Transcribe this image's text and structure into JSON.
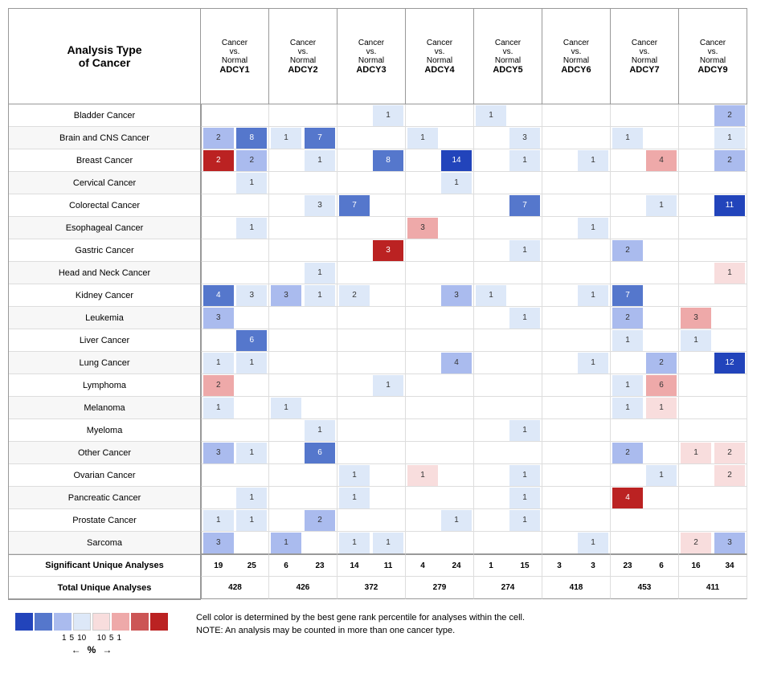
{
  "title": "Analysis Type\nof Cancer",
  "columns": [
    {
      "label": "Cancer\nvs.\nNormal",
      "gene": "ADCY1"
    },
    {
      "label": "Cancer\nvs.\nNormal",
      "gene": "ADCY2"
    },
    {
      "label": "Cancer\nvs.\nNormal",
      "gene": "ADCY3"
    },
    {
      "label": "Cancer\nvs.\nNormal",
      "gene": "ADCY4"
    },
    {
      "label": "Cancer\nvs.\nNormal",
      "gene": "ADCY5"
    },
    {
      "label": "Cancer\nvs.\nNormal",
      "gene": "ADCY6"
    },
    {
      "label": "Cancer\nvs.\nNormal",
      "gene": "ADCY7"
    },
    {
      "label": "Cancer\nvs.\nNormal",
      "gene": "ADCY9"
    }
  ],
  "rows": [
    {
      "label": "Bladder Cancer",
      "cells": [
        [
          "",
          ""
        ],
        [
          "",
          ""
        ],
        [
          "",
          ""
        ],
        [
          "1",
          "blue4"
        ],
        [
          "",
          ""
        ],
        [
          "1",
          "blue4"
        ],
        [
          "",
          ""
        ],
        [
          "",
          ""
        ],
        [
          "",
          ""
        ],
        [
          "2",
          "blue3"
        ]
      ]
    },
    {
      "label": "Brain and CNS Cancer",
      "cells": [
        [
          "2",
          "blue3"
        ],
        [
          "8",
          "blue2"
        ],
        [
          "1",
          "blue4"
        ],
        [
          "7",
          "blue2"
        ],
        [
          "",
          ""
        ],
        [
          "",
          ""
        ],
        [
          "1",
          "blue4"
        ],
        [
          "",
          ""
        ],
        [
          "3",
          "blue4"
        ],
        [
          "",
          ""
        ],
        [
          "",
          ""
        ],
        [
          "",
          ""
        ],
        [
          "1",
          "blue4"
        ],
        [
          "",
          ""
        ],
        [
          "",
          ""
        ],
        [
          "1",
          "blue4"
        ]
      ]
    },
    {
      "label": "Breast Cancer",
      "cells": [
        [
          "2",
          "red1"
        ],
        [
          "2",
          "blue3"
        ],
        [
          "",
          ""
        ],
        [
          "1",
          "blue4"
        ],
        [
          "",
          ""
        ],
        [
          "8",
          "blue2"
        ],
        [
          "",
          ""
        ],
        [
          "14",
          "blue1"
        ],
        [
          "",
          ""
        ],
        [
          "1",
          "blue4"
        ],
        [
          "",
          ""
        ],
        [
          "1",
          "blue4"
        ],
        [
          "",
          ""
        ],
        [
          "4",
          "pink2"
        ],
        [
          "",
          ""
        ],
        [
          "2",
          "blue3"
        ],
        [
          "",
          ""
        ]
      ]
    },
    {
      "label": "Cervical Cancer",
      "cells": [
        [
          "",
          ""
        ],
        [
          "1",
          "blue4"
        ],
        [
          "",
          ""
        ],
        [
          "",
          ""
        ],
        [
          "",
          ""
        ],
        [
          "",
          ""
        ],
        [
          "",
          ""
        ],
        [
          "1",
          "blue4"
        ],
        [
          "",
          ""
        ],
        [
          "",
          ""
        ],
        [
          "",
          ""
        ],
        [
          "",
          ""
        ],
        [
          "",
          ""
        ],
        [
          "",
          ""
        ],
        [
          "",
          ""
        ],
        [
          "",
          ""
        ]
      ]
    },
    {
      "label": "Colorectal Cancer",
      "cells": [
        [
          "",
          ""
        ],
        [
          "",
          ""
        ],
        [
          "",
          ""
        ],
        [
          "3",
          "blue4"
        ],
        [
          "7",
          "blue2"
        ],
        [
          "",
          ""
        ],
        [
          "",
          ""
        ],
        [
          "",
          ""
        ],
        [
          "",
          ""
        ],
        [
          "7",
          "blue2"
        ],
        [
          "",
          ""
        ],
        [
          "",
          ""
        ],
        [
          "",
          ""
        ],
        [
          "",
          ""
        ],
        [
          "1",
          "blue4"
        ],
        [
          "",
          ""
        ],
        [
          "11",
          "blue1"
        ]
      ]
    },
    {
      "label": "Esophageal Cancer",
      "cells": [
        [
          "",
          ""
        ],
        [
          "1",
          "blue4"
        ],
        [
          "",
          ""
        ],
        [
          "",
          ""
        ],
        [
          "",
          ""
        ],
        [
          "",
          ""
        ],
        [
          "3",
          "pink2"
        ],
        [
          "",
          ""
        ],
        [
          "",
          ""
        ],
        [
          "1",
          "blue4"
        ],
        [
          "",
          ""
        ],
        [
          "",
          ""
        ],
        [
          "",
          ""
        ],
        [
          "",
          ""
        ],
        [
          "",
          ""
        ]
      ]
    },
    {
      "label": "Gastric Cancer",
      "cells": [
        [
          "",
          ""
        ],
        [
          "",
          ""
        ],
        [
          "",
          ""
        ],
        [
          "",
          ""
        ],
        [
          "3",
          "red1"
        ],
        [
          "",
          ""
        ],
        [
          "",
          ""
        ],
        [
          "",
          ""
        ],
        [
          "",
          ""
        ],
        [
          "1",
          "blue4"
        ],
        [
          "",
          ""
        ],
        [
          "",
          ""
        ],
        [
          "2",
          "blue3"
        ],
        [
          "",
          ""
        ],
        [
          "",
          ""
        ]
      ]
    },
    {
      "label": "Head and Neck Cancer",
      "cells": [
        [
          "",
          ""
        ],
        [
          "",
          ""
        ],
        [
          "",
          ""
        ],
        [
          "1",
          "blue4"
        ],
        [
          "",
          ""
        ],
        [
          "",
          ""
        ],
        [
          "",
          ""
        ],
        [
          "",
          ""
        ],
        [
          "",
          ""
        ],
        [
          "",
          ""
        ],
        [
          "",
          ""
        ],
        [
          "",
          ""
        ],
        [
          "",
          ""
        ],
        [
          "",
          ""
        ],
        [
          "",
          ""
        ],
        [
          "1",
          "pink1"
        ]
      ]
    },
    {
      "label": "Kidney Cancer",
      "cells": [
        [
          "4",
          "blue2"
        ],
        [
          "3",
          "blue4"
        ],
        [
          "3",
          "blue3"
        ],
        [
          "1",
          "blue4"
        ],
        [
          "2",
          "blue4"
        ],
        [
          "",
          ""
        ],
        [
          "",
          ""
        ],
        [
          "3",
          "blue3"
        ],
        [
          "1",
          "blue4"
        ],
        [
          "",
          ""
        ],
        [
          "1",
          "blue4"
        ],
        [
          "",
          ""
        ],
        [
          "1",
          "blue4"
        ],
        [
          "7",
          "blue2"
        ],
        [
          "",
          ""
        ],
        [
          "",
          ""
        ]
      ]
    },
    {
      "label": "Leukemia",
      "cells": [
        [
          "3",
          "blue3"
        ],
        [
          "",
          ""
        ],
        [
          "",
          ""
        ],
        [
          "",
          ""
        ],
        [
          "",
          ""
        ],
        [
          "",
          ""
        ],
        [
          "",
          ""
        ],
        [
          "",
          ""
        ],
        [
          "",
          ""
        ],
        [
          "1",
          "blue4"
        ],
        [
          "",
          ""
        ],
        [
          "",
          ""
        ],
        [
          "2",
          "blue3"
        ],
        [
          "",
          ""
        ],
        [
          "3",
          "pink2"
        ],
        [
          "",
          ""
        ]
      ]
    },
    {
      "label": "Liver Cancer",
      "cells": [
        [
          "",
          ""
        ],
        [
          "6",
          "blue2"
        ],
        [
          "",
          ""
        ],
        [
          "",
          ""
        ],
        [
          "",
          ""
        ],
        [
          "",
          ""
        ],
        [
          "",
          ""
        ],
        [
          "",
          ""
        ],
        [
          "",
          ""
        ],
        [
          "",
          ""
        ],
        [
          "",
          ""
        ],
        [
          "",
          ""
        ],
        [
          "1",
          "blue4"
        ],
        [
          "",
          ""
        ],
        [
          "1",
          "blue4"
        ],
        [
          "",
          ""
        ]
      ]
    },
    {
      "label": "Lung Cancer",
      "cells": [
        [
          "1",
          "blue4"
        ],
        [
          "1",
          "blue4"
        ],
        [
          "",
          ""
        ],
        [
          "",
          ""
        ],
        [
          "",
          ""
        ],
        [
          "",
          ""
        ],
        [
          "",
          ""
        ],
        [
          "4",
          "blue3"
        ],
        [
          "",
          ""
        ],
        [
          "",
          ""
        ],
        [
          "",
          ""
        ],
        [
          "1",
          "blue4"
        ],
        [
          "",
          ""
        ],
        [
          "2",
          "blue3"
        ],
        [
          "",
          ""
        ],
        [
          "12",
          "blue1"
        ]
      ]
    },
    {
      "label": "Lymphoma",
      "cells": [
        [
          "2",
          "pink2"
        ],
        [
          "",
          ""
        ],
        [
          "",
          ""
        ],
        [
          "",
          ""
        ],
        [
          "1",
          "blue4"
        ],
        [
          "",
          ""
        ],
        [
          "",
          ""
        ],
        [
          "",
          ""
        ],
        [
          "",
          ""
        ],
        [
          "",
          ""
        ],
        [
          "",
          ""
        ],
        [
          "",
          ""
        ],
        [
          "1",
          "blue4"
        ],
        [
          "6",
          "pink2"
        ],
        [
          "",
          ""
        ]
      ]
    },
    {
      "label": "Melanoma",
      "cells": [
        [
          "1",
          "blue4"
        ],
        [
          "",
          ""
        ],
        [
          "1",
          "blue4"
        ],
        [
          "",
          ""
        ],
        [
          "",
          ""
        ],
        [
          "",
          ""
        ],
        [
          "",
          ""
        ],
        [
          "",
          ""
        ],
        [
          "",
          ""
        ],
        [
          "",
          ""
        ],
        [
          "",
          ""
        ],
        [
          "",
          ""
        ],
        [
          "1",
          "blue4"
        ],
        [
          "1",
          "pink1"
        ],
        [
          "",
          ""
        ]
      ]
    },
    {
      "label": "Myeloma",
      "cells": [
        [
          "",
          ""
        ],
        [
          "",
          ""
        ],
        [
          "",
          ""
        ],
        [
          "1",
          "blue4"
        ],
        [
          "",
          ""
        ],
        [
          "",
          ""
        ],
        [
          "",
          ""
        ],
        [
          "",
          ""
        ],
        [
          "",
          ""
        ],
        [
          "1",
          "blue4"
        ],
        [
          "",
          ""
        ],
        [
          "",
          ""
        ],
        [
          "",
          ""
        ],
        [
          "",
          ""
        ],
        [
          "",
          ""
        ]
      ]
    },
    {
      "label": "Other Cancer",
      "cells": [
        [
          "3",
          "blue3"
        ],
        [
          "1",
          "blue4"
        ],
        [
          "",
          ""
        ],
        [
          "6",
          "blue2"
        ],
        [
          "",
          ""
        ],
        [
          "",
          ""
        ],
        [
          "",
          ""
        ],
        [
          "",
          ""
        ],
        [
          "",
          ""
        ],
        [
          "",
          ""
        ],
        [
          "",
          ""
        ],
        [
          "",
          ""
        ],
        [
          "2",
          "blue3"
        ],
        [
          "",
          ""
        ],
        [
          "1",
          "pink1"
        ],
        [
          "2",
          "pink1"
        ]
      ]
    },
    {
      "label": "Ovarian Cancer",
      "cells": [
        [
          "",
          ""
        ],
        [
          "",
          ""
        ],
        [
          "",
          ""
        ],
        [
          "",
          ""
        ],
        [
          "1",
          "blue4"
        ],
        [
          "",
          ""
        ],
        [
          "1",
          "pink1"
        ],
        [
          "",
          ""
        ],
        [
          "",
          ""
        ],
        [
          "1",
          "blue4"
        ],
        [
          "",
          ""
        ],
        [
          "",
          ""
        ],
        [
          "",
          ""
        ],
        [
          "1",
          "blue4"
        ],
        [
          "",
          ""
        ],
        [
          "2",
          "pink1"
        ]
      ]
    },
    {
      "label": "Pancreatic Cancer",
      "cells": [
        [
          "",
          ""
        ],
        [
          "1",
          "blue4"
        ],
        [
          "",
          ""
        ],
        [
          "",
          ""
        ],
        [
          "1",
          "blue4"
        ],
        [
          "",
          ""
        ],
        [
          "",
          ""
        ],
        [
          "",
          ""
        ],
        [
          "",
          ""
        ],
        [
          "1",
          "blue4"
        ],
        [
          "",
          ""
        ],
        [
          "",
          ""
        ],
        [
          "4",
          "red1"
        ],
        [
          "",
          ""
        ],
        [
          "",
          ""
        ]
      ]
    },
    {
      "label": "Prostate Cancer",
      "cells": [
        [
          "1",
          "blue4"
        ],
        [
          "1",
          "blue4"
        ],
        [
          "",
          ""
        ],
        [
          "2",
          "blue3"
        ],
        [
          "",
          ""
        ],
        [
          "1",
          "blue4"
        ],
        [
          "",
          ""
        ],
        [
          "",
          ""
        ],
        [
          "",
          ""
        ],
        [
          "1",
          "blue4"
        ],
        [
          "",
          ""
        ],
        [
          "",
          ""
        ],
        [
          "",
          ""
        ],
        [
          "",
          ""
        ],
        [
          "",
          ""
        ]
      ]
    },
    {
      "label": "Sarcoma",
      "cells": [
        [
          "3",
          "blue3"
        ],
        [
          "",
          ""
        ],
        [
          "1",
          "blue3"
        ],
        [
          "",
          ""
        ],
        [
          "1",
          "blue4"
        ],
        [
          "1",
          "blue4"
        ],
        [
          "",
          ""
        ],
        [
          "",
          ""
        ],
        [
          "",
          ""
        ],
        [
          "",
          ""
        ],
        [
          "",
          ""
        ],
        [
          "1",
          "blue4"
        ],
        [
          "",
          ""
        ],
        [
          "",
          ""
        ],
        [
          "2",
          "pink1"
        ],
        [
          "3",
          "blue3"
        ]
      ]
    }
  ],
  "footer": {
    "sig_label": "Significant Unique Analyses",
    "total_label": "Total Unique Analyses",
    "sig_values": [
      "19",
      "25",
      "6",
      "23",
      "14",
      "11",
      "4",
      "24",
      "1",
      "15",
      "3",
      "3",
      "23",
      "6",
      "16",
      "34"
    ],
    "total_values": [
      "428",
      "",
      "426",
      "",
      "372",
      "",
      "279",
      "",
      "274",
      "",
      "418",
      "",
      "453",
      "",
      "411",
      ""
    ]
  },
  "legend": {
    "label": "%",
    "items": [
      "1",
      "5",
      "10",
      "",
      "10",
      "5",
      "1"
    ],
    "note1": "Cell color is determined by the best gene rank percentile for analyses within the cell.",
    "note2": "NOTE: An analysis may be counted in more than one cancer type."
  }
}
